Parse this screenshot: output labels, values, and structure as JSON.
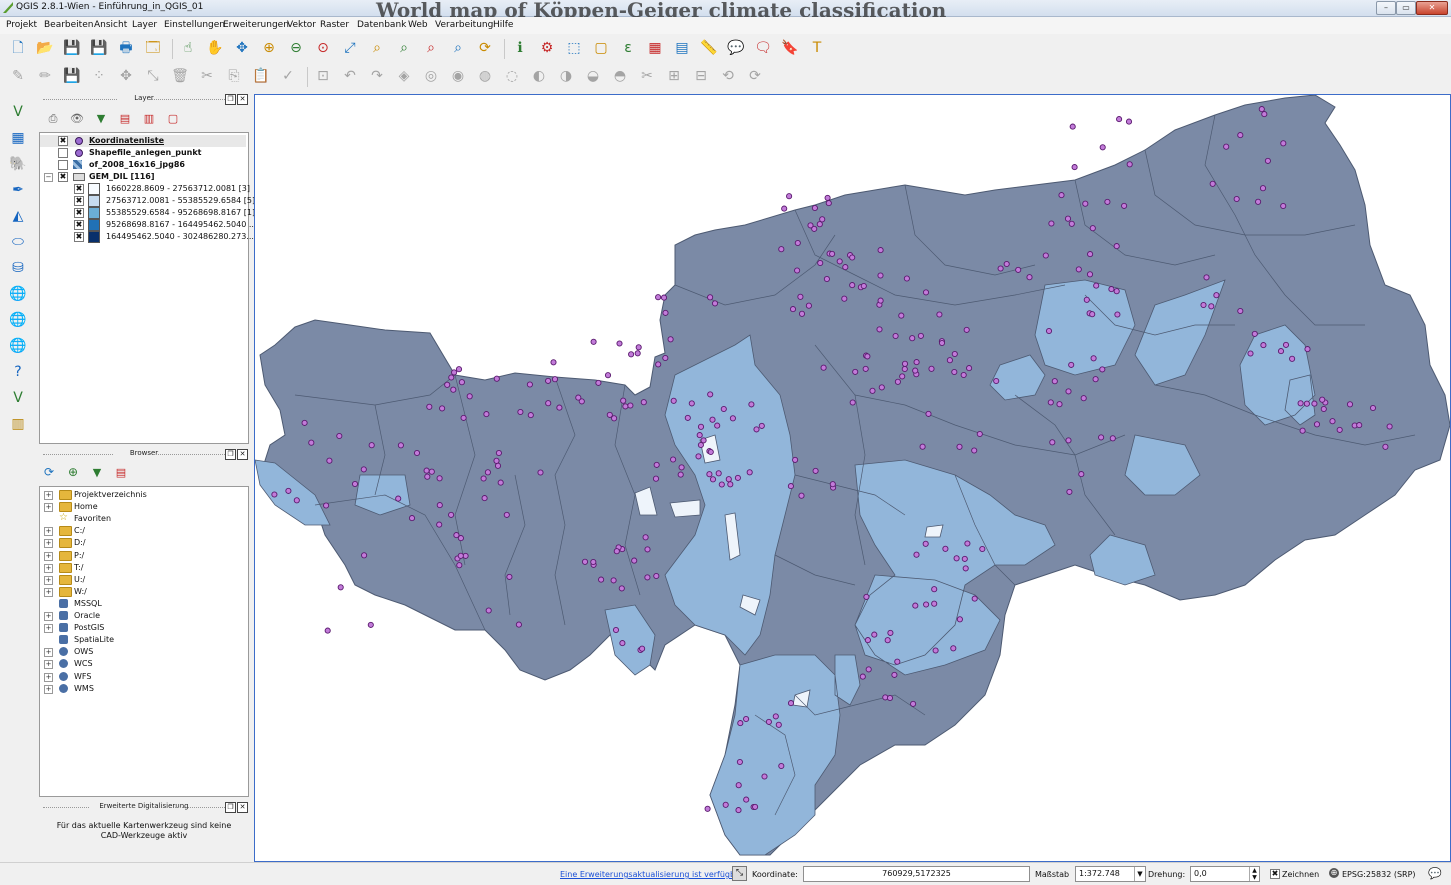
{
  "window": {
    "title": "QGIS 2.8.1-Wien - Einführung_in_QGIS_01",
    "bg_text": "World map of Köppen-Geiger climate classification"
  },
  "menu": [
    "Projekt",
    "Bearbeiten",
    "Ansicht",
    "Layer",
    "Einstellungen",
    "Erweiterungen",
    "Vektor",
    "Raster",
    "Datenbank",
    "Web",
    "Verarbeitung",
    "Hilfe"
  ],
  "toolbar1": [
    {
      "name": "new-project-icon",
      "glyph": "🗋"
    },
    {
      "name": "open-project-icon",
      "glyph": "📂"
    },
    {
      "name": "save-project-icon",
      "glyph": "💾"
    },
    {
      "name": "save-as-icon",
      "glyph": "💾"
    },
    {
      "name": "print-composer-icon",
      "glyph": "🖶"
    },
    {
      "name": "composer-manager-icon",
      "glyph": "🗔"
    },
    {
      "name": "touch-icon",
      "glyph": "☝"
    },
    {
      "name": "pan-icon",
      "glyph": "✋"
    },
    {
      "name": "pan-to-selection-icon",
      "glyph": "✥"
    },
    {
      "name": "zoom-in-icon",
      "glyph": "⊕"
    },
    {
      "name": "zoom-out-icon",
      "glyph": "⊖"
    },
    {
      "name": "zoom-actual-icon",
      "glyph": "⊙"
    },
    {
      "name": "zoom-full-icon",
      "glyph": "⤢"
    },
    {
      "name": "zoom-selection-icon",
      "glyph": "⌕"
    },
    {
      "name": "zoom-layer-icon",
      "glyph": "⌕"
    },
    {
      "name": "zoom-last-icon",
      "glyph": "⌕"
    },
    {
      "name": "zoom-next-icon",
      "glyph": "⌕"
    },
    {
      "name": "refresh-icon",
      "glyph": "⟳"
    },
    {
      "name": "identify-icon",
      "glyph": "ℹ"
    },
    {
      "name": "action-icon",
      "glyph": "⚙"
    },
    {
      "name": "select-icon",
      "glyph": "⬚"
    },
    {
      "name": "deselect-icon",
      "glyph": "▢"
    },
    {
      "name": "expression-select-icon",
      "glyph": "ε"
    },
    {
      "name": "attribute-table-icon",
      "glyph": "▦"
    },
    {
      "name": "statistics-icon",
      "glyph": "▤"
    },
    {
      "name": "measure-icon",
      "glyph": "📏"
    },
    {
      "name": "annotation-icon",
      "glyph": "💬"
    },
    {
      "name": "map-tips-icon",
      "glyph": "🗨"
    },
    {
      "name": "bookmark-icon",
      "glyph": "🔖"
    },
    {
      "name": "text-annotation-icon",
      "glyph": "T"
    }
  ],
  "toolbar2": [
    {
      "name": "current-edits-icon",
      "glyph": "✎"
    },
    {
      "name": "toggle-editing-icon",
      "glyph": "✏"
    },
    {
      "name": "save-edits-icon",
      "glyph": "💾"
    },
    {
      "name": "add-feature-icon",
      "glyph": "⁘"
    },
    {
      "name": "move-feature-icon",
      "glyph": "✥"
    },
    {
      "name": "node-tool-icon",
      "glyph": "⤡"
    },
    {
      "name": "delete-selected-icon",
      "glyph": "🗑"
    },
    {
      "name": "cut-features-icon",
      "glyph": "✂"
    },
    {
      "name": "copy-features-icon",
      "glyph": "⎘"
    },
    {
      "name": "paste-features-icon",
      "glyph": "📋"
    },
    {
      "name": "digitize-icon",
      "glyph": "✓"
    },
    {
      "name": "label-icon",
      "glyph": "⊡"
    },
    {
      "name": "undo-icon",
      "glyph": "↶"
    },
    {
      "name": "redo-icon",
      "glyph": "↷"
    },
    {
      "name": "simplify-icon",
      "glyph": "◈"
    },
    {
      "name": "add-ring-icon",
      "glyph": "◎"
    },
    {
      "name": "add-part-icon",
      "glyph": "◉"
    },
    {
      "name": "fill-ring-icon",
      "glyph": "◍"
    },
    {
      "name": "delete-ring-icon",
      "glyph": "◌"
    },
    {
      "name": "delete-part-icon",
      "glyph": "◐"
    },
    {
      "name": "reshape-icon",
      "glyph": "◑"
    },
    {
      "name": "offset-curve-icon",
      "glyph": "◒"
    },
    {
      "name": "split-features-icon",
      "glyph": "◓"
    },
    {
      "name": "split-parts-icon",
      "glyph": "✂"
    },
    {
      "name": "merge-features-icon",
      "glyph": "⊞"
    },
    {
      "name": "merge-attributes-icon",
      "glyph": "⊟"
    },
    {
      "name": "rotate-point-icon",
      "glyph": "⟲"
    },
    {
      "name": "rotate-feature-icon",
      "glyph": "⟳"
    }
  ],
  "layers_panel": {
    "title": "Layer",
    "items": [
      {
        "label": "Koordinatenliste",
        "checked": "✖",
        "type": "point",
        "bold": true,
        "underline": true
      },
      {
        "label": "Shapefile_anlegen_punkt",
        "checked": "",
        "type": "point",
        "bold": true
      },
      {
        "label": "of_2008_16x16_jpg86",
        "checked": "",
        "type": "raster",
        "bold": true
      },
      {
        "label": "GEM_DIL [116]",
        "checked": "✖",
        "type": "polygon",
        "bold": true
      }
    ],
    "legend": [
      {
        "label": "1660228.8609 - 27563712.0081  [3]",
        "color": "#f7fbff"
      },
      {
        "label": "27563712.0081 - 55385529.6584  [5]",
        "color": "#c6dbef"
      },
      {
        "label": "55385529.6584 - 95268698.8167  [1]",
        "color": "#6baed6"
      },
      {
        "label": "95268698.8167 - 164495462.5040 ...",
        "color": "#2171b5"
      },
      {
        "label": "164495462.5040 - 302486280.273...",
        "color": "#08306b"
      }
    ]
  },
  "browser_panel": {
    "title": "Browser",
    "items": [
      {
        "label": "Projektverzeichnis",
        "icon": "folder-icon"
      },
      {
        "label": "Home",
        "icon": "folder-icon"
      },
      {
        "label": "Favoriten",
        "icon": "star-icon"
      },
      {
        "label": "C:/",
        "icon": "folder-icon"
      },
      {
        "label": "D:/",
        "icon": "folder-icon"
      },
      {
        "label": "P:/",
        "icon": "folder-icon"
      },
      {
        "label": "T:/",
        "icon": "folder-icon"
      },
      {
        "label": "U:/",
        "icon": "folder-icon"
      },
      {
        "label": "W:/",
        "icon": "folder-icon"
      },
      {
        "label": "MSSQL",
        "icon": "mssql-icon"
      },
      {
        "label": "Oracle",
        "icon": "oracle-icon"
      },
      {
        "label": "PostGIS",
        "icon": "postgis-icon"
      },
      {
        "label": "SpatiaLite",
        "icon": "spatialite-icon"
      },
      {
        "label": "OWS",
        "icon": "globe-icon"
      },
      {
        "label": "WCS",
        "icon": "globe-icon"
      },
      {
        "label": "WFS",
        "icon": "globe-icon"
      },
      {
        "label": "WMS",
        "icon": "globe-icon"
      }
    ]
  },
  "digitizing_panel": {
    "title": "Erweiterte Digitalisierung",
    "message": "Für das aktuelle Kartenwerkzeug sind keine CAD-Werkzeuge aktiv"
  },
  "statusbar": {
    "update_link": "Eine Erweiterungsaktualisierung ist verfügbar",
    "coord_label": "Koordinate:",
    "coord_value": "760929,5172325",
    "scale_label": "Maßstab",
    "scale_value": "1:372.748",
    "rotation_label": "Drehung:",
    "rotation_value": "0,0",
    "render_label": "Zeichnen",
    "crs_label": "EPSG:25832 (SRP)"
  },
  "colors": {
    "map_dark": "#7b8aa6",
    "map_light": "#92b6da",
    "point_fill": "#c27bd9",
    "point_stroke": "#5a1a6e",
    "border": "#4d5a72"
  }
}
